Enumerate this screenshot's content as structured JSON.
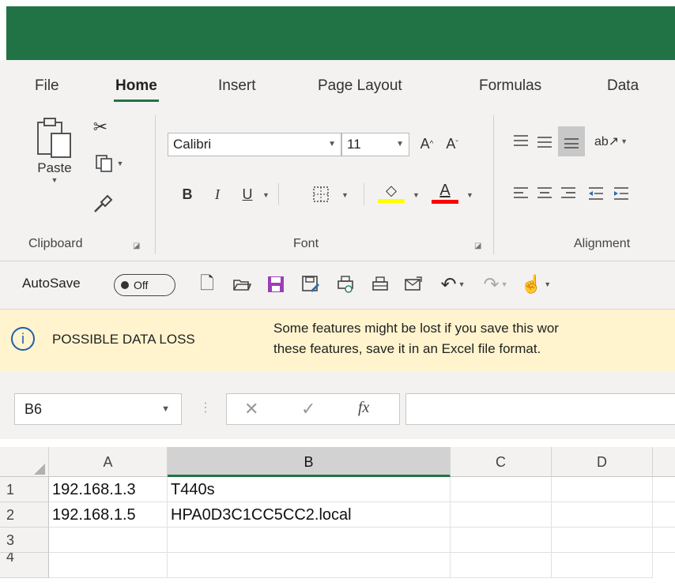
{
  "ribbon_tabs": [
    {
      "label": "File"
    },
    {
      "label": "Home"
    },
    {
      "label": "Insert"
    },
    {
      "label": "Page Layout"
    },
    {
      "label": "Formulas"
    },
    {
      "label": "Data"
    }
  ],
  "clipboard": {
    "paste_label": "Paste",
    "group_label": "Clipboard"
  },
  "font": {
    "family": "Calibri",
    "size": "11",
    "group_label": "Font",
    "bold": "B",
    "italic": "I",
    "underline": "U",
    "font_color_letter": "A"
  },
  "alignment": {
    "group_label": "Alignment"
  },
  "qat": {
    "autosave_label": "AutoSave",
    "autosave_state": "Off"
  },
  "message_bar": {
    "title": "POSSIBLE DATA LOSS",
    "line1": "Some features might be lost if you save this wor",
    "line2": "these features, save it in an Excel file format."
  },
  "formula_bar": {
    "name_box": "B6",
    "fx": "fx",
    "value": ""
  },
  "grid": {
    "columns": [
      "A",
      "B",
      "C",
      "D"
    ],
    "rows": [
      {
        "num": "1",
        "A": "192.168.1.3",
        "B": "T440s"
      },
      {
        "num": "2",
        "A": "192.168.1.5",
        "B": "HPA0D3C1CC5CC2.local"
      },
      {
        "num": "3",
        "A": "",
        "B": ""
      },
      {
        "num": "4",
        "A": "",
        "B": ""
      }
    ]
  },
  "colors": {
    "excel_green": "#217346",
    "message_bar": "#fff4ce",
    "highlight_yellow": "#ffff00",
    "font_red": "#ff0000",
    "save_purple": "#9b3fb7"
  }
}
